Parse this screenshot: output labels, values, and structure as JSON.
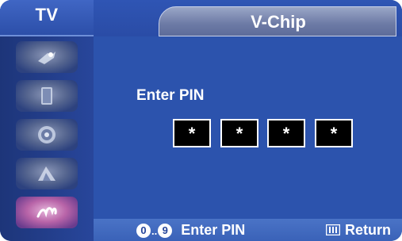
{
  "header": {
    "source_label": "TV",
    "title": "V-Chip"
  },
  "sidebar": {
    "items": [
      {
        "icon": "input-icon",
        "active": false
      },
      {
        "icon": "picture-icon",
        "active": false
      },
      {
        "icon": "sound-icon",
        "active": false
      },
      {
        "icon": "channel-icon",
        "active": false
      },
      {
        "icon": "setup-icon",
        "active": true
      }
    ]
  },
  "pin_entry": {
    "label": "Enter PIN",
    "digits": [
      "*",
      "*",
      "*",
      "*"
    ]
  },
  "footer": {
    "number_start": "0",
    "number_sep": "..",
    "number_end": "9",
    "enter_label": "Enter PIN",
    "menu_icon": "menu-icon",
    "return_label": "Return"
  },
  "colors": {
    "background": "#2c53ad",
    "sidebar": "#1d3579",
    "title_pill": "#7c89b1",
    "pin_box": "#000000",
    "text": "#ffffff"
  }
}
